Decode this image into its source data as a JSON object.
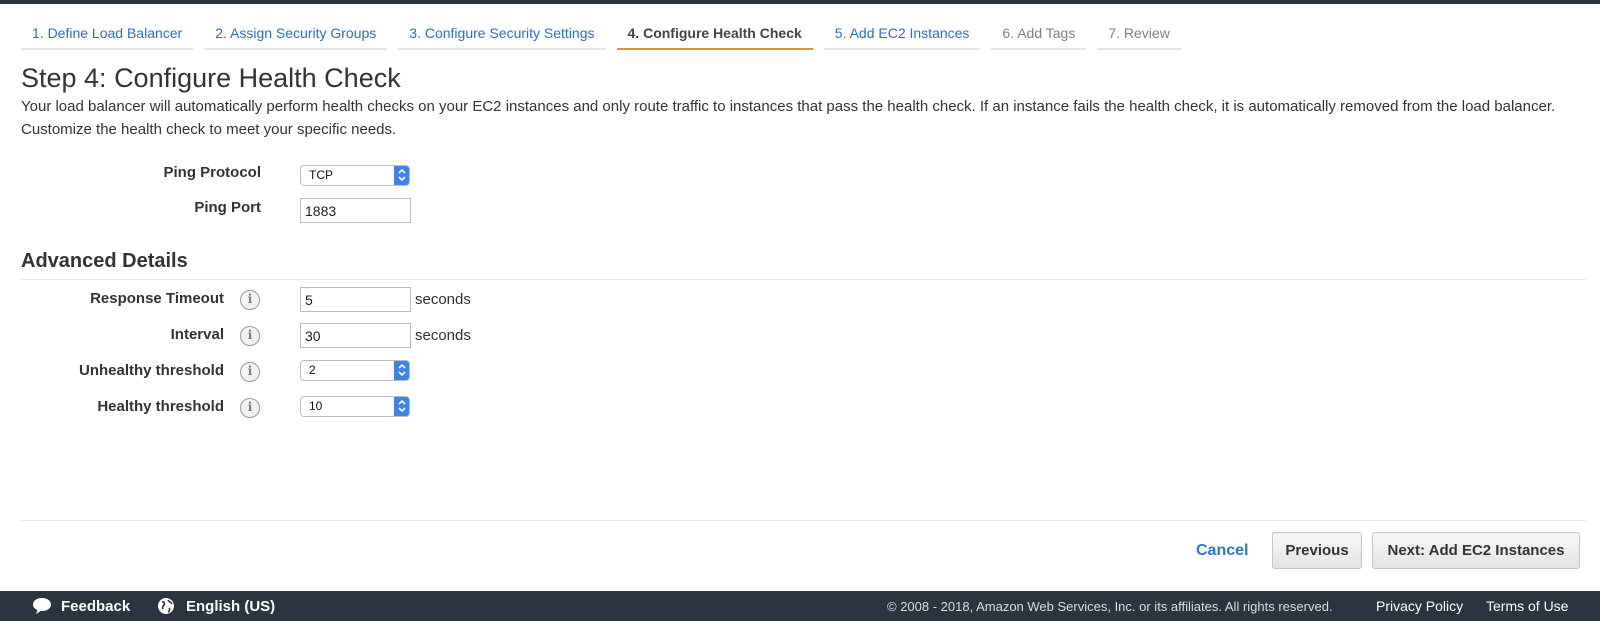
{
  "wizard": {
    "tabs": [
      {
        "label": "1. Define Load Balancer",
        "state": "link"
      },
      {
        "label": "2. Assign Security Groups",
        "state": "link"
      },
      {
        "label": "3. Configure Security Settings",
        "state": "link"
      },
      {
        "label": "4. Configure Health Check",
        "state": "active"
      },
      {
        "label": "5. Add EC2 Instances",
        "state": "link"
      },
      {
        "label": "6. Add Tags",
        "state": "disabled"
      },
      {
        "label": "7. Review",
        "state": "disabled"
      }
    ]
  },
  "page": {
    "title": "Step 4: Configure Health Check",
    "description": "Your load balancer will automatically perform health checks on your EC2 instances and only route traffic to instances that pass the health check. If an instance fails the health check, it is automatically removed from the load balancer. Customize the health check to meet your specific needs."
  },
  "health_check": {
    "ping_protocol": {
      "label": "Ping Protocol",
      "value": "TCP"
    },
    "ping_port": {
      "label": "Ping Port",
      "value": "1883"
    }
  },
  "advanced": {
    "title": "Advanced Details",
    "response_timeout": {
      "label": "Response Timeout",
      "value": "5",
      "unit": "seconds"
    },
    "interval": {
      "label": "Interval",
      "value": "30",
      "unit": "seconds"
    },
    "unhealthy_threshold": {
      "label": "Unhealthy threshold",
      "value": "2"
    },
    "healthy_threshold": {
      "label": "Healthy threshold",
      "value": "10"
    }
  },
  "actions": {
    "cancel": "Cancel",
    "previous": "Previous",
    "next": "Next: Add EC2 Instances"
  },
  "footer": {
    "feedback": "Feedback",
    "language": "English (US)",
    "copyright": "© 2008 - 2018, Amazon Web Services, Inc. or its affiliates. All rights reserved.",
    "privacy": "Privacy Policy",
    "terms": "Terms of Use"
  },
  "colors": {
    "link": "#2d6fbd",
    "active_tab_underline": "#e88f2b",
    "footer_bg": "#2b3540",
    "select_arrow": "#3f83e8"
  },
  "icons": {
    "info": "info-icon",
    "select_arrow": "chevron-updown-icon",
    "feedback": "speech-bubble-icon",
    "language": "globe-icon"
  }
}
